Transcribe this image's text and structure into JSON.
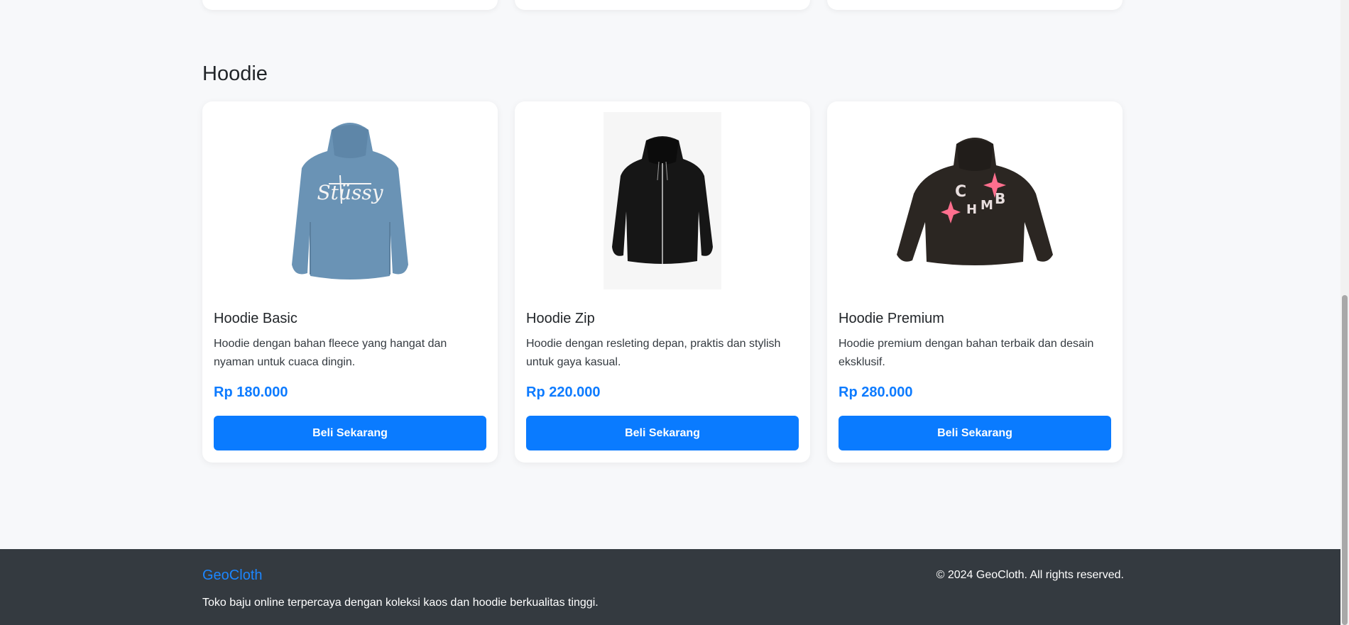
{
  "section": {
    "title": "Hoodie"
  },
  "products": [
    {
      "name": "Hoodie Basic",
      "description": "Hoodie dengan bahan fleece yang hangat dan nyaman untuk cuaca dingin.",
      "price": "Rp 180.000",
      "button_label": "Beli Sekarang",
      "image": "blue-hoodie-with-graffiti-logo",
      "image_logo_text": "Stüssy"
    },
    {
      "name": "Hoodie Zip",
      "description": "Hoodie dengan resleting depan, praktis dan stylish untuk gaya kasual.",
      "price": "Rp 220.000",
      "button_label": "Beli Sekarang",
      "image": "black-zip-hoodie"
    },
    {
      "name": "Hoodie Premium",
      "description": "Hoodie premium dengan bahan terbaik dan desain eksklusif.",
      "price": "Rp 280.000",
      "button_label": "Beli Sekarang",
      "image": "black-hoodie-with-puff-print-letters",
      "image_letters": [
        "C",
        "H",
        "M",
        "B"
      ]
    }
  ],
  "footer": {
    "brand": "GeoCloth",
    "tagline": "Toko baju online terpercaya dengan koleksi kaos dan hoodie berkualitas tinggi.",
    "copyright": "© 2024 GeoCloth. All rights reserved."
  },
  "colors": {
    "accent": "#0a7bff",
    "background": "#f7f8fa",
    "footer_bg": "#343a40",
    "card_bg": "#ffffff"
  }
}
